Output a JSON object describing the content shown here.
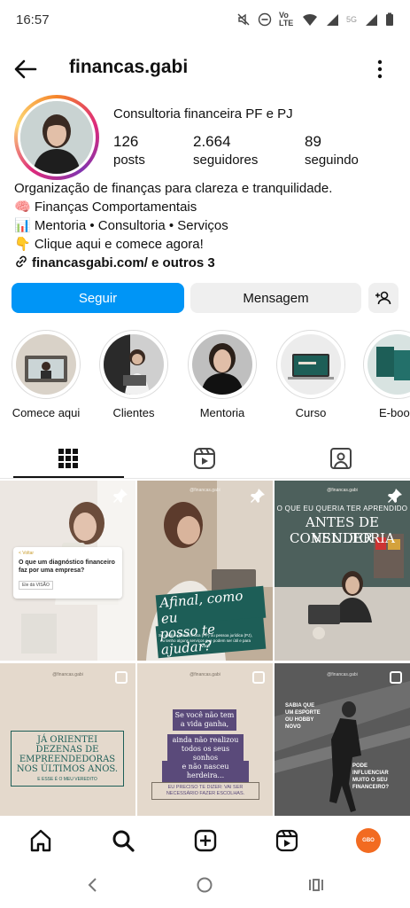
{
  "status_bar": {
    "time": "16:57",
    "network": "Vo LTE",
    "signal_label": "5G"
  },
  "header": {
    "username": "financas.gabi"
  },
  "profile": {
    "full_name": "Consultoria financeira PF e PJ",
    "stats": [
      {
        "value": "126",
        "label": "posts"
      },
      {
        "value": "2.664",
        "label": "seguidores"
      },
      {
        "value": "89",
        "label": "seguindo"
      }
    ],
    "bio": [
      "Organização de finanças para clareza e tranquilidade.",
      "🧠 Finanças Comportamentais",
      "📊 Mentoria • Consultoria • Serviços",
      "👇 Clique aqui e comece agora!"
    ],
    "link": "financasgabi.com/ e outros 3"
  },
  "buttons": {
    "follow": "Seguir",
    "message": "Mensagem"
  },
  "highlights": [
    {
      "label": "Comece aqui"
    },
    {
      "label": "Clientes"
    },
    {
      "label": "Mentoria"
    },
    {
      "label": "Curso"
    },
    {
      "label": "E-boo"
    }
  ],
  "posts": [
    {
      "back": "< Voltar",
      "text": "O que um diagnóstico financeiro faz por uma empresa?",
      "cta": "Ele dá VISÃO"
    },
    {
      "handle": "@financas.gabi",
      "text_1": "Afinal, como eu",
      "text_2": "posso te ajudar?",
      "small": "Se você é pessoa física (PF) ou pessoa jurídica (PJ), eu tenho alguns serviços que podem ser útil e para você"
    },
    {
      "handle": "@financas.gabi",
      "text_1": "O QUE EU QUERIA TER APRENDIDO",
      "text_2": "ANTES DE VENDER",
      "text_3": "CONSULTORIA"
    },
    {
      "handle": "@financas.gabi",
      "text_1": "JÁ ORIENTEI DEZENAS DE EMPREENDEDORAS NOS ÚLTIMOS ANOS.",
      "small": "E ESSE É O MEU VEREDITO"
    },
    {
      "handle": "@financas.gabi",
      "text_1": "Se você não tem a vida ganha,",
      "text_2": "ainda não realizou todos os seus sonhos",
      "text_3": "e não nasceu herdeira...",
      "small": "EU PRECISO TE DIZER: VAI SER NECESSÁRIO FAZER ESCOLHAS."
    },
    {
      "handle": "@financas.gabi",
      "text_1": "SABIA QUE UM ESPORTE OU HOBBY NOVO",
      "text_2": "PODE INFLUENCIAR MUITO O SEU FINANCEIRO?"
    }
  ],
  "nav_avatar_text": "GBO",
  "colors": {
    "accent": "#0095f6",
    "button_gray": "#efefef",
    "post_beige": "#e9dfd3",
    "post_teal": "#1d5e57"
  }
}
